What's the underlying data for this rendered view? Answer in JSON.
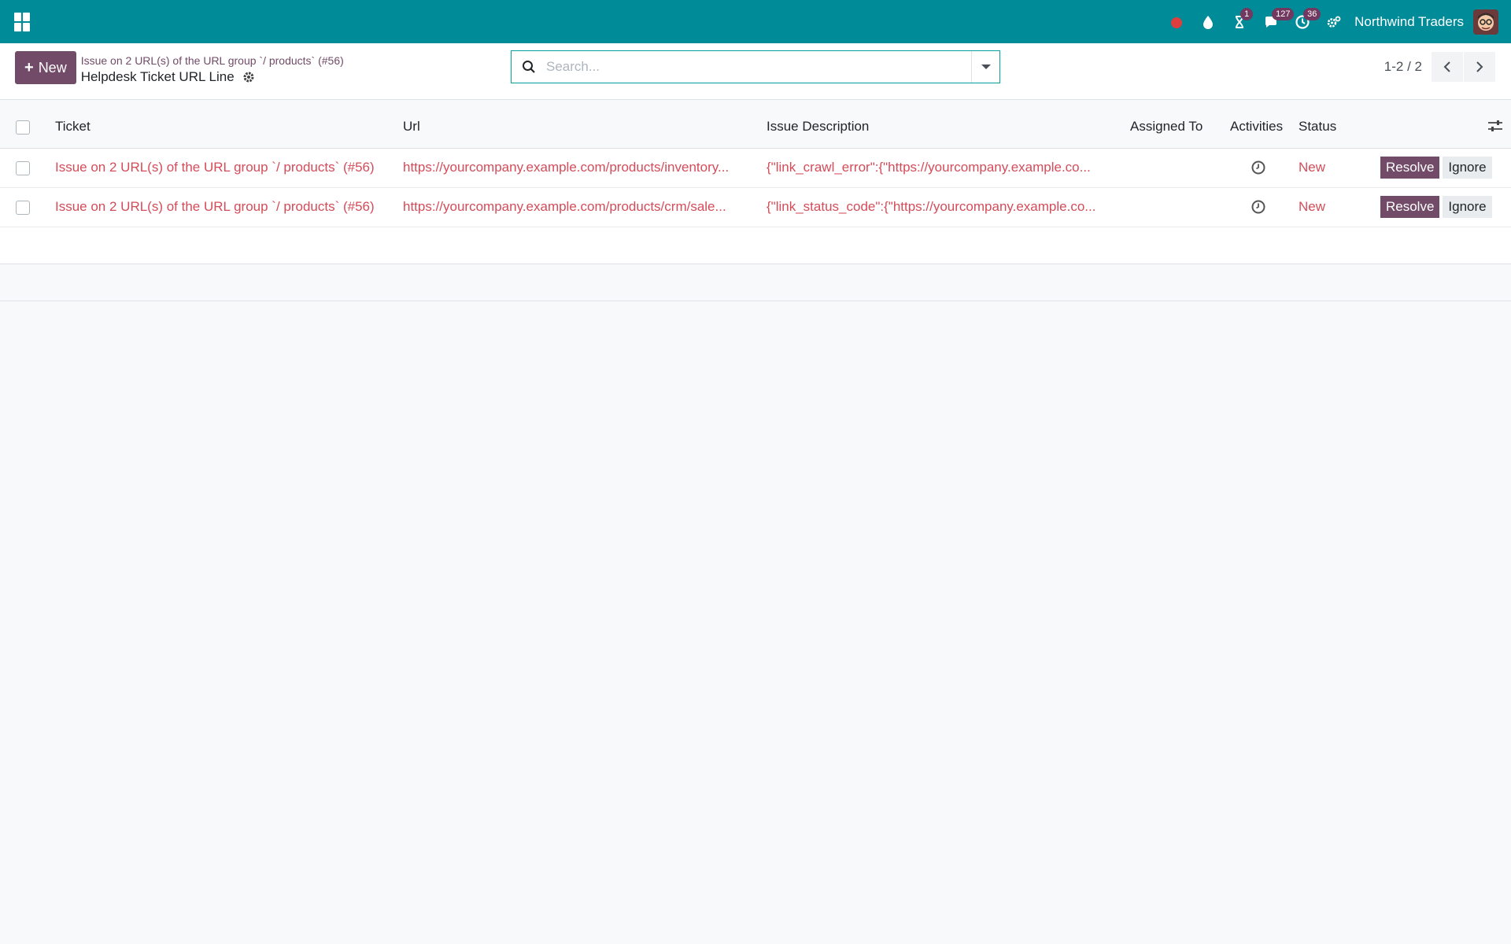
{
  "navbar": {
    "company": "Northwind Traders",
    "icons": [
      {
        "name": "record-dot-icon",
        "color": "#e03e3e"
      },
      {
        "name": "drop-icon"
      },
      {
        "name": "hourglass-icon",
        "badge": "1"
      },
      {
        "name": "chat-icon",
        "badge": "127"
      },
      {
        "name": "activity-clock-icon",
        "badge": "36"
      },
      {
        "name": "settings-gears-icon"
      }
    ]
  },
  "control_panel": {
    "new_label": "New",
    "breadcrumb": "Issue on 2 URL(s) of the URL group `/ products` (#56)",
    "title": "Helpdesk Ticket URL Line",
    "search_placeholder": "Search...",
    "pager": "1-2 / 2"
  },
  "table": {
    "headers": {
      "ticket": "Ticket",
      "url": "Url",
      "description": "Issue Description",
      "assigned": "Assigned To",
      "activities": "Activities",
      "status": "Status"
    },
    "rows": [
      {
        "ticket": "Issue on 2 URL(s) of the URL group `/ products` (#56)",
        "url": "https://yourcompany.example.com/products/inventory...",
        "description": "{\"link_crawl_error\":{\"https://yourcompany.example.co...",
        "assigned": "",
        "status": "New",
        "resolve": "Resolve",
        "ignore": "Ignore"
      },
      {
        "ticket": "Issue on 2 URL(s) of the URL group `/ products` (#56)",
        "url": "https://yourcompany.example.com/products/crm/sale...",
        "description": "{\"link_status_code\":{\"https://yourcompany.example.co...",
        "assigned": "",
        "status": "New",
        "resolve": "Resolve",
        "ignore": "Ignore"
      }
    ]
  },
  "colors": {
    "navbar": "#008b98",
    "primary": "#714b67",
    "danger_text": "#d44c59",
    "badge": "#71395f"
  }
}
